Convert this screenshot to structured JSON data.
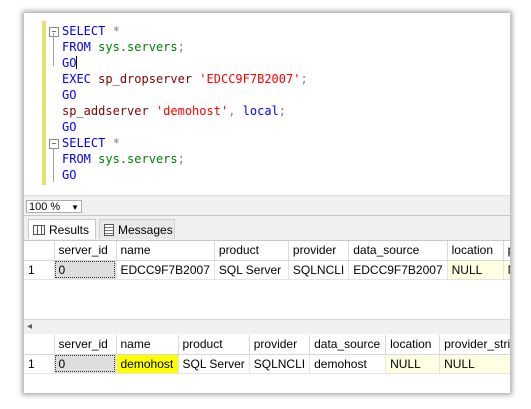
{
  "editor": {
    "lines": [
      {
        "fold": "−",
        "parts": [
          {
            "t": "SELECT",
            "c": "kw"
          },
          {
            "t": " ",
            "c": ""
          },
          {
            "t": "*",
            "c": "gray"
          }
        ]
      },
      {
        "fold": "",
        "parts": [
          {
            "t": "FROM",
            "c": "kw"
          },
          {
            "t": " ",
            "c": ""
          },
          {
            "t": "sys.servers",
            "c": "sysobj"
          },
          {
            "t": ";",
            "c": "gray"
          }
        ]
      },
      {
        "fold": "",
        "parts": [
          {
            "t": "GO",
            "c": "kw"
          }
        ],
        "caret": true
      },
      {
        "fold": "",
        "parts": [
          {
            "t": "EXEC",
            "c": "kw"
          },
          {
            "t": " ",
            "c": ""
          },
          {
            "t": "sp_dropserver",
            "c": "fn"
          },
          {
            "t": " ",
            "c": ""
          },
          {
            "t": "'EDCC9F7B2007'",
            "c": "str"
          },
          {
            "t": ";",
            "c": "gray"
          }
        ]
      },
      {
        "fold": "",
        "parts": [
          {
            "t": "GO",
            "c": "kw"
          }
        ]
      },
      {
        "fold": "",
        "parts": [
          {
            "t": "sp_addserver",
            "c": "fn"
          },
          {
            "t": " ",
            "c": ""
          },
          {
            "t": "'demohost'",
            "c": "str"
          },
          {
            "t": ", ",
            "c": "gray"
          },
          {
            "t": "local",
            "c": "kw"
          },
          {
            "t": ";",
            "c": "gray"
          }
        ]
      },
      {
        "fold": "",
        "parts": [
          {
            "t": "GO",
            "c": "kw"
          }
        ]
      },
      {
        "fold": "−",
        "parts": [
          {
            "t": "SELECT",
            "c": "kw"
          },
          {
            "t": " ",
            "c": ""
          },
          {
            "t": "*",
            "c": "gray"
          }
        ]
      },
      {
        "fold": "",
        "parts": [
          {
            "t": "FROM",
            "c": "kw"
          },
          {
            "t": " ",
            "c": ""
          },
          {
            "t": "sys.servers",
            "c": "sysobj"
          },
          {
            "t": ";",
            "c": "gray"
          }
        ]
      },
      {
        "fold": "",
        "parts": [
          {
            "t": "GO",
            "c": "kw"
          }
        ]
      }
    ]
  },
  "zoom": {
    "value": "100 %",
    "arrow": "▼"
  },
  "tabs": {
    "results": "Results",
    "messages": "Messages"
  },
  "grid1": {
    "headers": [
      "",
      "server_id",
      "name",
      "product",
      "provider",
      "data_source",
      "location",
      "pro"
    ],
    "rows": [
      [
        "1",
        "0",
        "EDCC9F7B2007",
        "SQL Server",
        "SQLNCLI",
        "EDCC9F7B2007",
        "NULL",
        "NU"
      ]
    ]
  },
  "grid2": {
    "headers": [
      "",
      "server_id",
      "name",
      "product",
      "provider",
      "data_source",
      "location",
      "provider_strin"
    ],
    "rows": [
      [
        "1",
        "0",
        "demohost",
        "SQL Server",
        "SQLNCLI",
        "demohost",
        "NULL",
        "NULL"
      ]
    ]
  },
  "scroll": {
    "left_arrow": "◂"
  }
}
